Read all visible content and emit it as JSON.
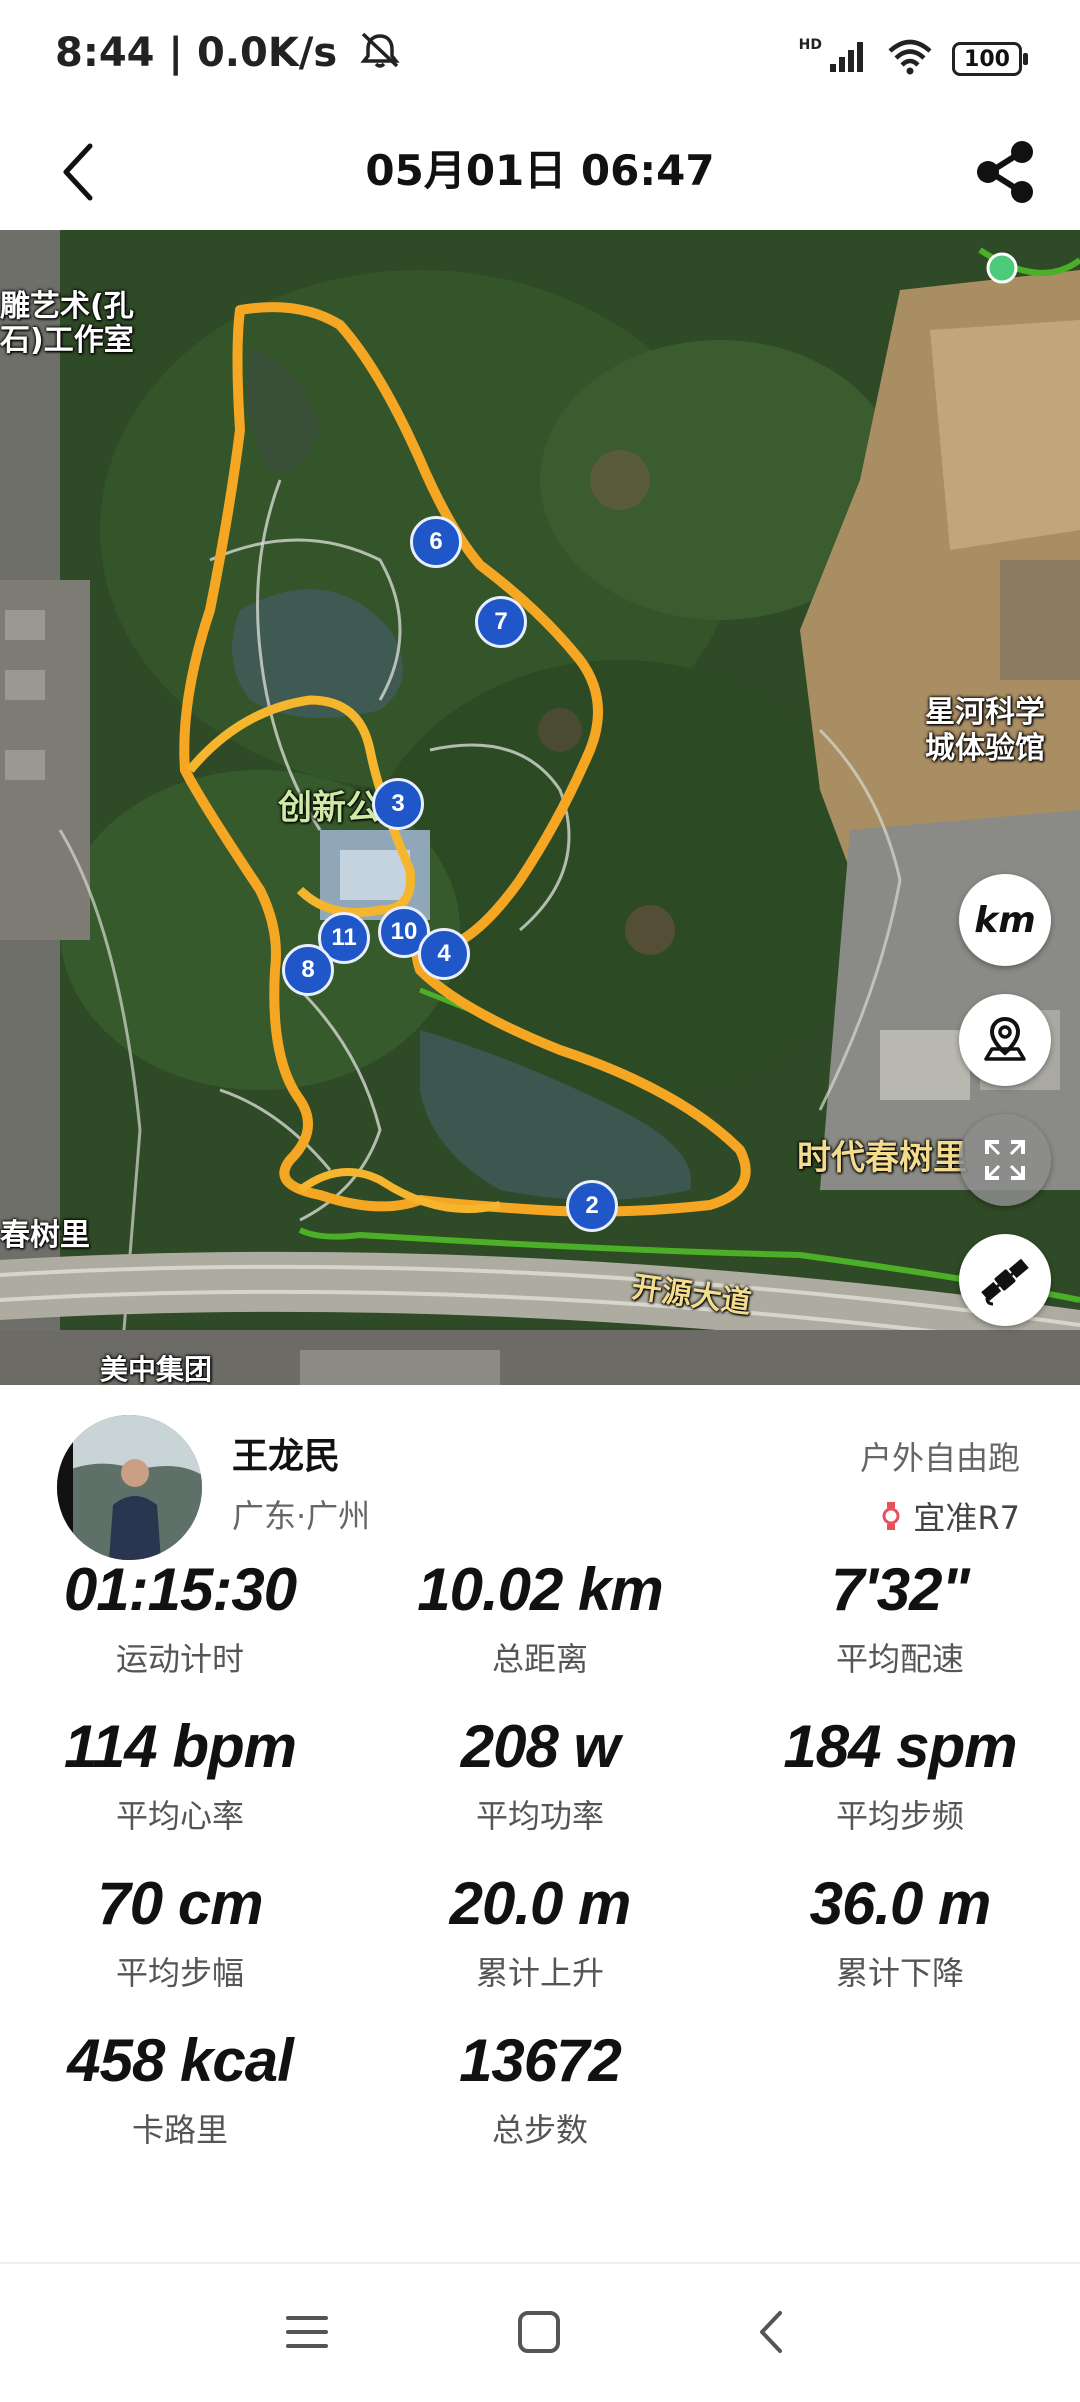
{
  "status_bar": {
    "time_speed": "8:44 | 0.0K/s",
    "network_tag": "HD",
    "battery": "100",
    "icons": [
      "mute-icon",
      "signal-icon",
      "wifi-icon",
      "battery-icon"
    ]
  },
  "header": {
    "title": "05月01日 06:47",
    "back_icon": "chevron-left-icon",
    "share_icon": "share-icon"
  },
  "map": {
    "labels": {
      "studio": "雕艺术(孔\n石)工作室",
      "park": "创新公园",
      "museum": "星河科学\n城体验馆",
      "community": "时代春树里",
      "community_left": "春树里",
      "road": "开源大道",
      "group": "美中集团"
    },
    "markers": [
      "2",
      "3",
      "4",
      "6",
      "7",
      "8",
      "10",
      "11"
    ],
    "buttons": {
      "unit": "km",
      "location_icon": "map-pin-icon",
      "fullscreen_icon": "fullscreen-icon",
      "satellite_icon": "satellite-icon"
    },
    "colors": {
      "route": "#f5a623",
      "path": "#4caf28",
      "marker": "#1f57c9"
    }
  },
  "profile": {
    "name": "王龙民",
    "location": "广东·广州",
    "sport_type": "户外自由跑",
    "device": "宜准R7"
  },
  "stats": [
    {
      "value": "01:15:30",
      "label": "运动计时"
    },
    {
      "value": "10.02 km",
      "label": "总距离"
    },
    {
      "value": "7'32\"",
      "label": "平均配速"
    },
    {
      "value": "114 bpm",
      "label": "平均心率"
    },
    {
      "value": "208 w",
      "label": "平均功率"
    },
    {
      "value": "184 spm",
      "label": "平均步频"
    },
    {
      "value": "70 cm",
      "label": "平均步幅"
    },
    {
      "value": "20.0 m",
      "label": "累计上升"
    },
    {
      "value": "36.0 m",
      "label": "累计下降"
    },
    {
      "value": "458 kcal",
      "label": "卡路里"
    },
    {
      "value": "13672",
      "label": "总步数"
    }
  ],
  "nav_bar": [
    "menu-icon",
    "home-icon",
    "back-icon"
  ]
}
